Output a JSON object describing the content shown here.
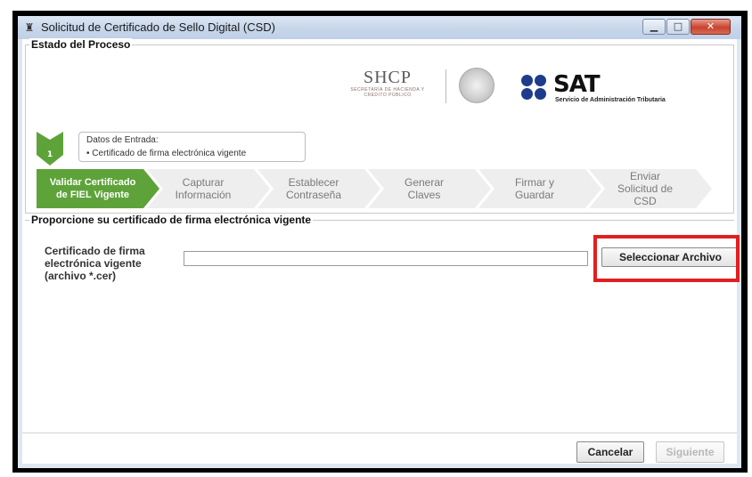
{
  "window": {
    "title": "Solicitud de Certificado de Sello Digital (CSD)",
    "icon": "app-icon",
    "controls": {
      "minimize": "minimize-icon",
      "maximize": "maximize-icon",
      "close": "close-icon"
    }
  },
  "process_group": {
    "title": "Estado del Proceso"
  },
  "logos": {
    "shcp": "SHCP",
    "shcp_sub": "SECRETARÍA DE HACIENDA Y CRÉDITO PÚBLICO",
    "sat": "SAT",
    "sat_sub": "Servicio de Administración Tributaria"
  },
  "info": {
    "step_number": "1",
    "heading": "Datos de Entrada:",
    "item": "•  Certificado de firma electrónica vigente"
  },
  "steps": [
    {
      "label": "Validar Certificado de FIEL Vigente",
      "active": true
    },
    {
      "label": "Capturar Información",
      "active": false
    },
    {
      "label": "Establecer Contraseña",
      "active": false
    },
    {
      "label": "Generar Claves",
      "active": false
    },
    {
      "label": "Firmar y Guardar",
      "active": false
    },
    {
      "label": "Enviar Solicitud de CSD",
      "active": false
    }
  ],
  "form_group": {
    "title": "Proporcione su certificado de firma electrónica vigente",
    "field_label": "Certificado de firma electrónica vigente (archivo *.cer)",
    "field_value": "",
    "select_button": "Seleccionar Archivo"
  },
  "footer": {
    "cancel": "Cancelar",
    "next": "Siguiente"
  },
  "colors": {
    "active_step": "#5ea33a",
    "inactive_step": "#eeeeee",
    "highlight": "#e02020",
    "sat_blue": "#1f3c8c"
  }
}
